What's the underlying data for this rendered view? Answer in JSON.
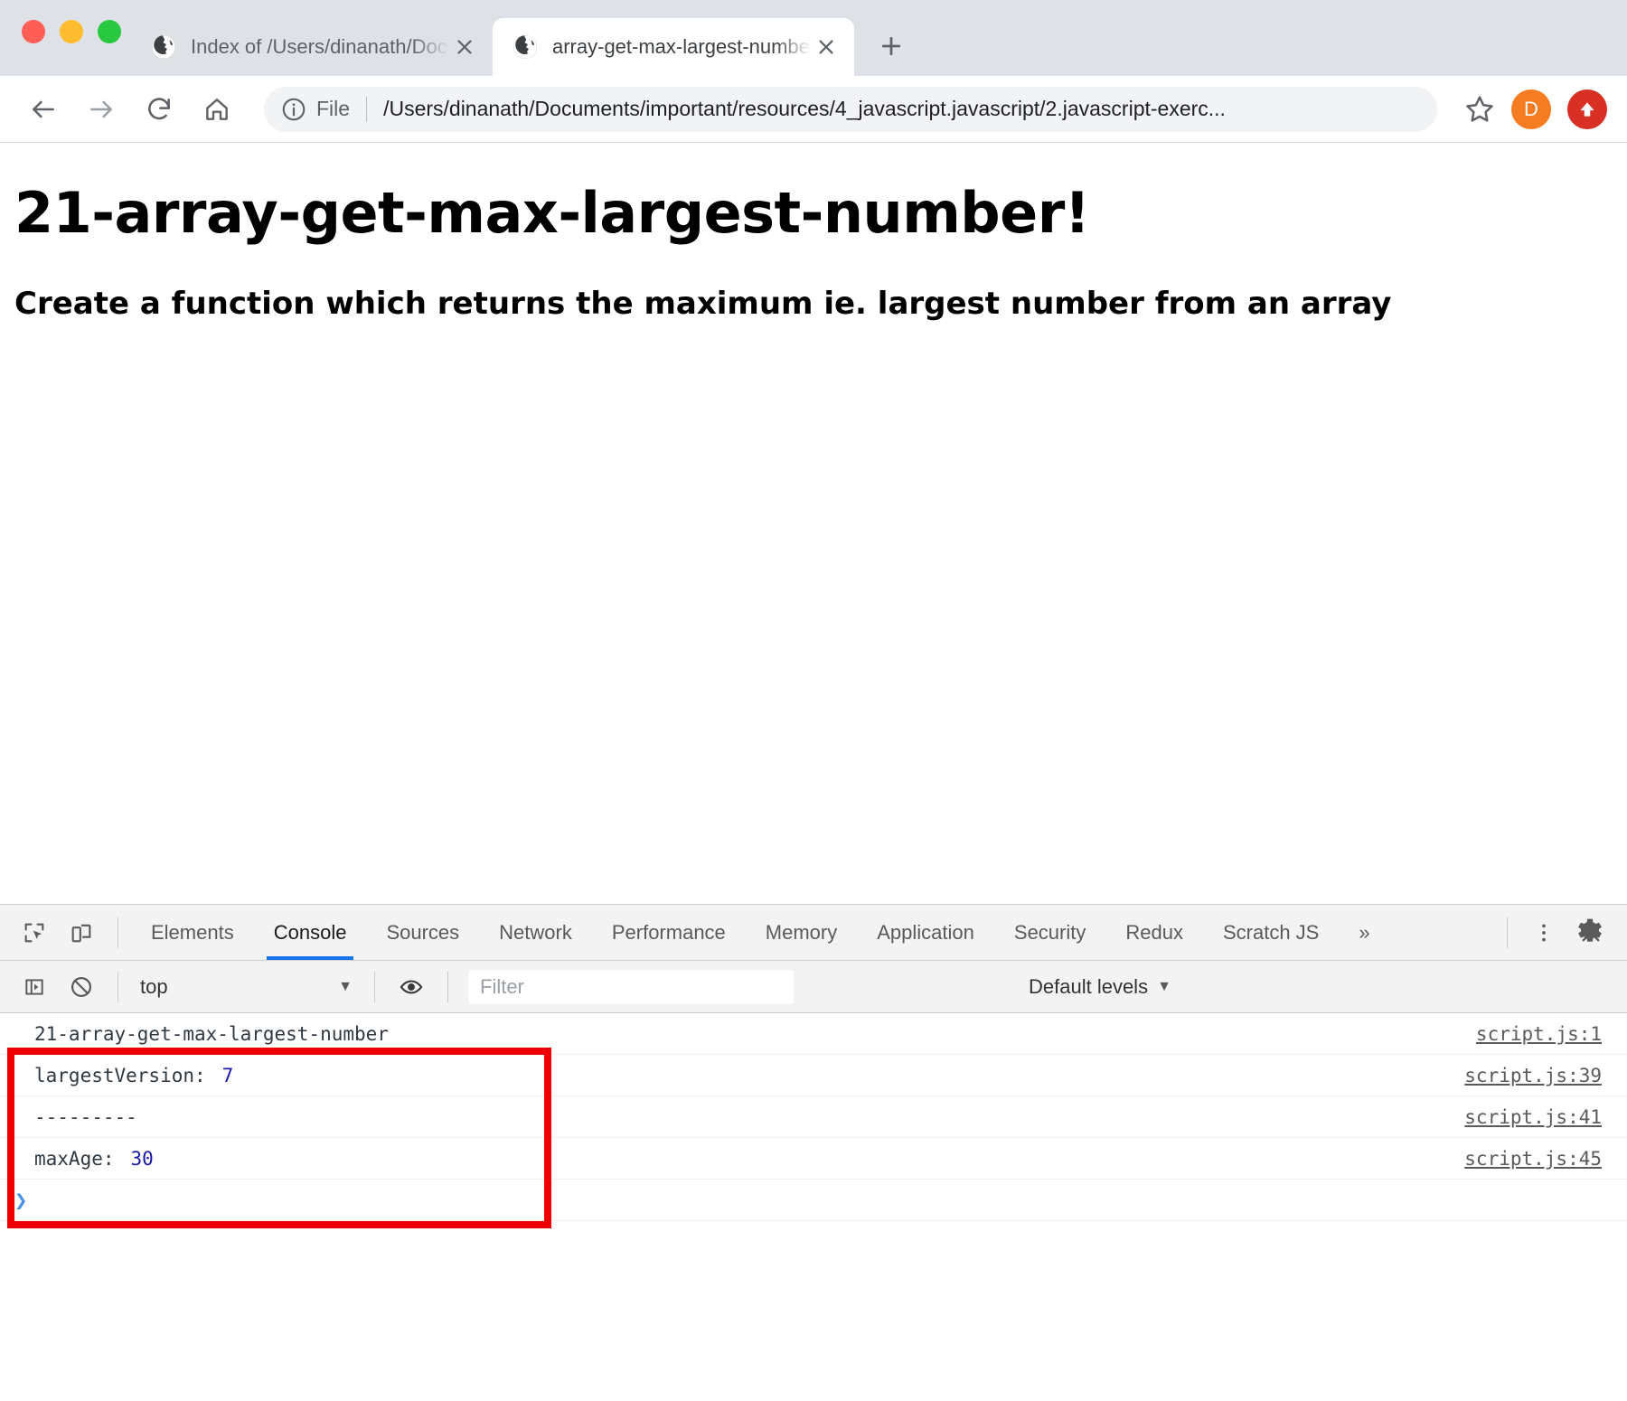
{
  "browser": {
    "traffic_lights": [
      "close",
      "minimize",
      "maximize"
    ],
    "tabs": [
      {
        "title": "Index of /Users/dinanath/Docum",
        "favicon": "globe-icon",
        "active": false
      },
      {
        "title": "array-get-max-largest-number",
        "favicon": "globe-icon",
        "active": true
      }
    ],
    "new_tab_label": "+",
    "toolbar": {
      "back": "back-arrow",
      "forward": "forward-arrow",
      "reload": "reload-icon",
      "home": "home-icon",
      "scheme_label": "File",
      "url": "/Users/dinanath/Documents/important/resources/4_javascript.javascript/2.javascript-exerc...",
      "bookmark": "star-icon",
      "profile_initial": "D",
      "profile_color": "#f57c20",
      "update_color": "#d93025"
    }
  },
  "page": {
    "heading": "21-array-get-max-largest-number!",
    "subheading": "Create a function which returns the maximum ie. largest number from an array"
  },
  "devtools": {
    "tabs": [
      {
        "label": "Elements",
        "active": false
      },
      {
        "label": "Console",
        "active": true
      },
      {
        "label": "Sources",
        "active": false
      },
      {
        "label": "Network",
        "active": false
      },
      {
        "label": "Performance",
        "active": false
      },
      {
        "label": "Memory",
        "active": false
      },
      {
        "label": "Application",
        "active": false
      },
      {
        "label": "Security",
        "active": false
      },
      {
        "label": "Redux",
        "active": false
      },
      {
        "label": "Scratch JS",
        "active": false
      }
    ],
    "overflow_label": "»",
    "more_icon": "kebab-menu-icon",
    "close_icon": "close-icon",
    "inspect_icon": "inspect-element-icon",
    "device_icon": "device-toolbar-icon",
    "active_tab_color": "#1a73e8",
    "toolbar": {
      "sidebar_toggle": "console-sidebar-icon",
      "clear_console": "clear-console-icon",
      "context": "top",
      "context_caret": "▼",
      "live_expression": "eye-icon",
      "filter_placeholder": "Filter",
      "filter_value": "",
      "levels_label": "Default levels",
      "levels_caret": "▼",
      "settings_icon": "gear-icon"
    },
    "console_rows": [
      {
        "label": "21-array-get-max-largest-number",
        "value": "",
        "source": "script.js:1"
      },
      {
        "label": "largestVersion:",
        "value": "7",
        "source": "script.js:39"
      },
      {
        "label": "---------",
        "value": "",
        "source": "script.js:41"
      },
      {
        "label": "maxAge:",
        "value": "30",
        "source": "script.js:45"
      }
    ],
    "prompt_caret": "❯",
    "annotation_color": "#ee0000"
  }
}
